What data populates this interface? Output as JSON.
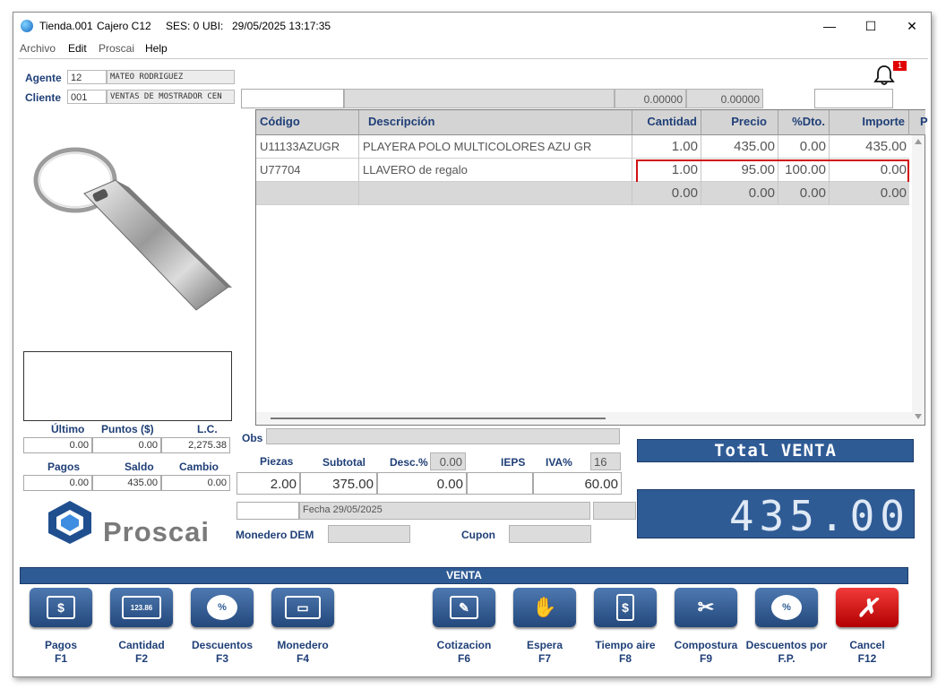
{
  "titlebar": {
    "store": "Tienda.001",
    "cashier": "Cajero C12",
    "session": "SES: 0",
    "ubi": "UBI:",
    "datetime": "29/05/2025 13:17:35",
    "minimize": "—",
    "maximize": "☐",
    "close": "✕"
  },
  "menu": [
    "Archivo",
    "Edit",
    "Proscai",
    "Help"
  ],
  "agent": {
    "label": "Agente",
    "code": "12",
    "name": "MATEO RODRIGUEZ"
  },
  "client": {
    "label": "Cliente",
    "code": "001",
    "name": "VENTAS DE MOSTRADOR CEN"
  },
  "notifications": {
    "count": "1"
  },
  "topbar": {
    "val1": "0.00000",
    "val2": "0.00000"
  },
  "grid": {
    "columns": [
      "Código",
      "Descripción",
      "Cantidad",
      "Precio",
      "%Dto.",
      "Importe",
      "P"
    ],
    "rows": [
      {
        "code": "U11133AZUGR",
        "desc": "PLAYERA POLO MULTICOLORES AZU GR",
        "qty": "1.00",
        "price": "435.00",
        "dto": "0.00",
        "amount": "435.00"
      },
      {
        "code": "U77704",
        "desc": "LLAVERO de regalo",
        "qty": "1.00",
        "price": "95.00",
        "dto": "100.00",
        "amount": "0.00"
      },
      {
        "code": "",
        "desc": "",
        "qty": "0.00",
        "price": "0.00",
        "dto": "0.00",
        "amount": "0.00"
      }
    ]
  },
  "stats": {
    "ultimo_label": "Último",
    "puntos_label": "Puntos ($)",
    "lc_label": "L.C.",
    "ultimo": "0.00",
    "puntos": "0.00",
    "lc": "2,275.38",
    "pagos_label": "Pagos",
    "saldo_label": "Saldo",
    "cambio_label": "Cambio",
    "pagos": "0.00",
    "saldo": "435.00",
    "cambio": "0.00"
  },
  "logo": "Proscai",
  "obs_label": "Obs",
  "totals": {
    "piezas_label": "Piezas",
    "subtotal_label": "Subtotal",
    "desc_label": "Desc.%",
    "desc_pct": "0.00",
    "ieps_label": "IEPS",
    "iva_label": "IVA%",
    "iva_pct": "16",
    "piezas": "2.00",
    "subtotal": "375.00",
    "desc": "0.00",
    "ieps": "",
    "iva": "60.00"
  },
  "fecha": "Fecha 29/05/2025",
  "monedero_label": "Monedero DEM",
  "cupon_label": "Cupon",
  "total_banner": "Total VENTA",
  "total_amount": "435.00",
  "venta_bar": "VENTA",
  "function_buttons": [
    {
      "label": "Pagos",
      "key": "F1",
      "icon": "$"
    },
    {
      "label": "Cantidad",
      "key": "F2",
      "icon": "123.86"
    },
    {
      "label": "Descuentos",
      "key": "F3",
      "icon": "%"
    },
    {
      "label": "Monedero",
      "key": "F4",
      "icon": "▭"
    },
    {
      "label": "Cotizacion",
      "key": "F6",
      "icon": "✎"
    },
    {
      "label": "Espera",
      "key": "F7",
      "icon": "✋"
    },
    {
      "label": "Tiempo aire",
      "key": "F8",
      "icon": "$"
    },
    {
      "label": "Compostura",
      "key": "F9",
      "icon": "✂"
    },
    {
      "label": "Descuentos por",
      "key": "F.P.",
      "icon": "%"
    },
    {
      "label": "Cancel",
      "key": "F12",
      "icon": "✗"
    }
  ]
}
